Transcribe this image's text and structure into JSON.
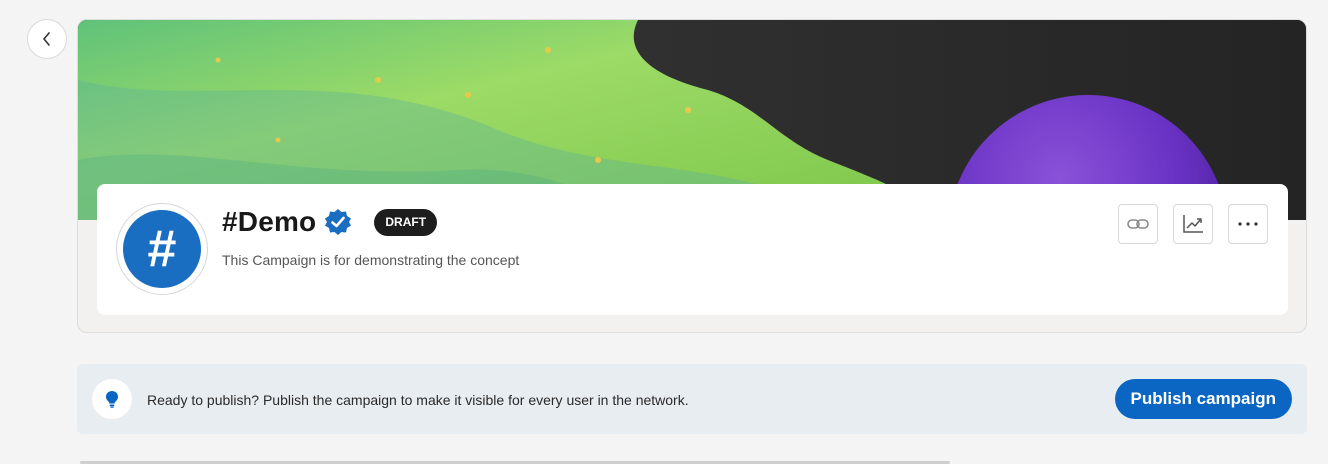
{
  "header": {
    "back_icon": "chevron-left-icon"
  },
  "campaign": {
    "avatar_symbol": "#",
    "title": "#Demo",
    "verified_icon": "verified-badge-icon",
    "status_badge": "DRAFT",
    "description": "This Campaign is for demonstrating the concept"
  },
  "actions": {
    "items": [
      {
        "icon": "link-icon"
      },
      {
        "icon": "analytics-icon"
      },
      {
        "icon": "more-icon"
      }
    ]
  },
  "notice": {
    "icon": "lightbulb-icon",
    "text": "Ready to publish? Publish the campaign to make it visible for every user in the network.",
    "button_label": "Publish campaign"
  },
  "colors": {
    "accent": "#0a66c2",
    "avatar_bg": "#1a6ec2",
    "badge_bg": "#1d1d1d",
    "notice_bg": "#e8edf2"
  }
}
